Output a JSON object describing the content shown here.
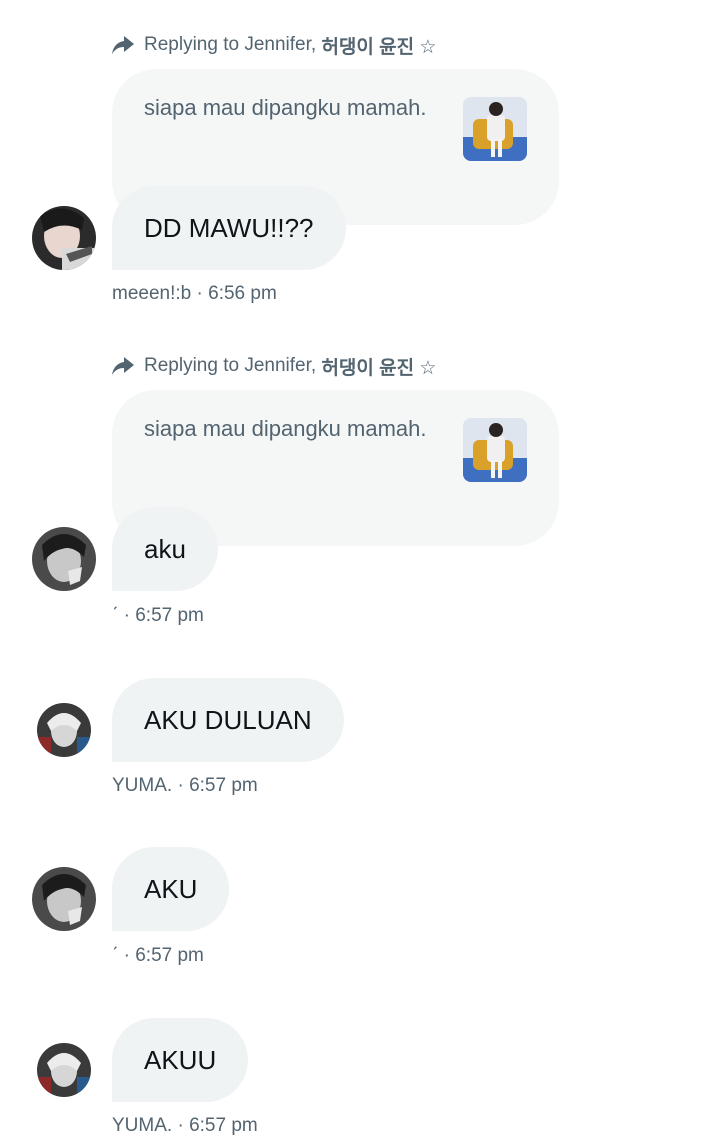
{
  "groups": [
    {
      "reply": {
        "prefix": "Replying to Jennifer,",
        "names": "허댕이 윤진 ☆"
      },
      "quote_text": "siapa mau dipangku mamah.",
      "message": "DD MAWU!!??",
      "sender": "meeen!:b",
      "time": "6:56 pm",
      "avatar_icon": "avatar-photo"
    },
    {
      "reply": {
        "prefix": "Replying to Jennifer,",
        "names": "허댕이 윤진 ☆"
      },
      "quote_text": "siapa mau dipangku mamah.",
      "message": "aku",
      "sender": "ˊ",
      "time": "6:57 pm",
      "avatar_icon": "avatar-photo"
    },
    {
      "message": "AKU DULUAN",
      "sender": "YUMA.",
      "time": "6:57 pm",
      "avatar_icon": "avatar-photo"
    },
    {
      "message": "AKU",
      "sender": "ˊ",
      "time": "6:57 pm",
      "avatar_icon": "avatar-photo"
    },
    {
      "message": "AKUU",
      "sender": "YUMA.",
      "time": "6:57 pm",
      "avatar_icon": "avatar-photo"
    }
  ],
  "separator": "·",
  "colors": {
    "bubble_bg": "#eff3f4",
    "quote_bg": "#f5f7f7",
    "secondary_text": "#536471",
    "primary_text": "#0f1419"
  }
}
